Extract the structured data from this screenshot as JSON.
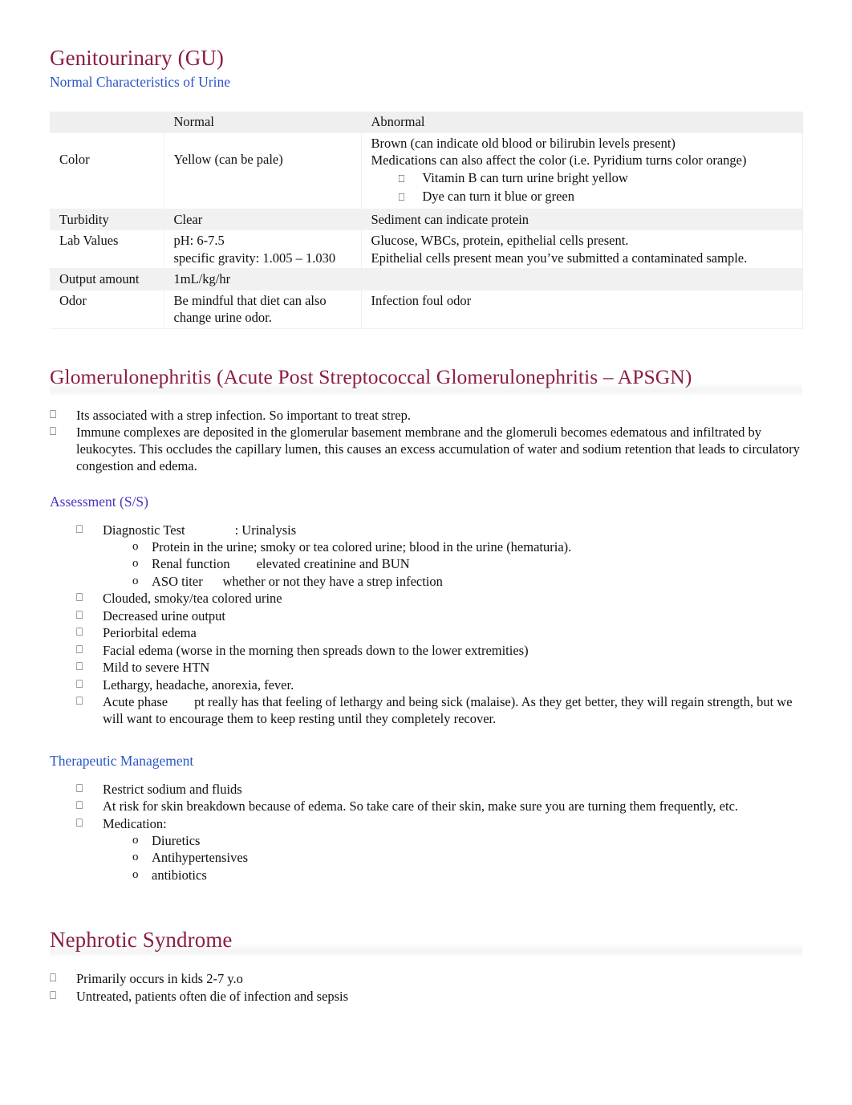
{
  "document": {
    "title": "Genitourinary (GU)",
    "subtitle": "Normal Characteristics of Urine"
  },
  "colors": {
    "heading_maroon": "#8C1D45",
    "heading_blue": "#2B55C8",
    "heading_purple": "#4A33C4",
    "row_shade": "#f1f1f1",
    "text": "#111111"
  },
  "urine_table": {
    "columns": [
      "",
      "Normal",
      "Abnormal"
    ],
    "rows": [
      {
        "label": "Color",
        "normal": "Yellow (can be pale)",
        "abnormal_lines": [
          "Brown (can indicate old blood or bilirubin levels present)",
          "Medications can also affect the color (i.e. Pyridium turns color orange)"
        ],
        "abnormal_bullets": [
          "Vitamin B can turn urine bright yellow",
          "Dye can turn it blue or green"
        ]
      },
      {
        "label": "Turbidity",
        "normal": "Clear",
        "abnormal_lines": [
          "Sediment      can indicate protein"
        ],
        "abnormal_bullets": []
      },
      {
        "label": "Lab Values",
        "normal": "pH: 6-7.5\nspecific gravity: 1.005 – 1.030",
        "abnormal_lines": [
          "Glucose, WBCs, protein, epithelial cells present.",
          "Epithelial cells present mean you’ve submitted a contaminated sample."
        ],
        "abnormal_bullets": []
      },
      {
        "label": "Output amount",
        "normal": "1mL/kg/hr",
        "abnormal_lines": [],
        "abnormal_bullets": []
      },
      {
        "label": "Odor",
        "normal": "Be mindful that diet can also change urine odor.",
        "abnormal_lines": [
          "Infection      foul odor"
        ],
        "abnormal_bullets": []
      }
    ]
  },
  "glomerulonephritis": {
    "heading": "Glomerulonephritis (Acute Post Streptococcal Glomerulonephritis – APSGN)",
    "intro_bullets": [
      "Its associated with a strep infection. So important to treat strep.",
      "Immune complexes are deposited in the glomerular basement membrane and the glomeruli becomes edematous and infiltrated by leukocytes. This occludes the capillary lumen, this causes an excess accumulation of water and sodium retention that leads to circulatory congestion and edema."
    ],
    "assessment": {
      "heading": "Assessment (S/S)",
      "diagnostic_test_label": "Diagnostic Test",
      "diagnostic_test_value": ": Urinalysis",
      "diagnostic_sub": [
        "Protein in the urine; smoky or tea colored urine; blood in the urine (hematuria).",
        "Renal function        elevated creatinine and BUN",
        "ASO titer      whether or not they have a strep infection"
      ],
      "bullets": [
        "Clouded, smoky/tea colored urine",
        "Decreased urine output",
        "Periorbital edema",
        "Facial edema (worse in the morning then spreads down to the lower extremities)",
        "Mild to severe HTN",
        "Lethargy, headache, anorexia, fever.",
        "Acute phase        pt really has that feeling of lethargy and being sick (malaise). As they get better, they will regain strength, but we will want to encourage them to keep resting until they completely recover."
      ]
    },
    "therapeutic": {
      "heading": "Therapeutic Management",
      "bullets": [
        "Restrict sodium and fluids",
        "At risk for skin breakdown because of edema. So take care of their skin, make sure you are turning them frequently, etc.",
        "Medication:"
      ],
      "medication_sub": [
        "Diuretics",
        "Antihypertensives",
        "antibiotics"
      ]
    }
  },
  "nephrotic": {
    "heading": "Nephrotic Syndrome",
    "bullets": [
      "Primarily occurs in kids 2-7 y.o",
      "Untreated, patients often die of infection and sepsis"
    ]
  },
  "icons": {
    "bullet_box": "⎕",
    "bullet_o": "o"
  }
}
